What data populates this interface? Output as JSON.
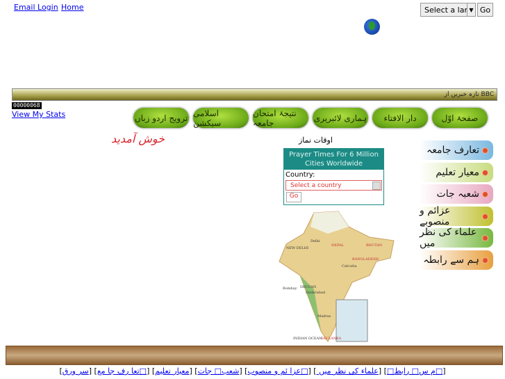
{
  "top": {
    "email_login": "Email Login",
    "home": "Home",
    "language_select": "Select a language",
    "go": "Go"
  },
  "news_ticker": "تازہ خبریں از BBC",
  "counter": "00000068",
  "view_stats": "View My Stats",
  "nav": [
    "صفحۂ اوّل",
    "دار الافتاء",
    "ہماری لائبریری",
    "نتیجۂ امتحان جامعہ",
    "اسلامی سیکشن",
    "ترویج اردو زباں"
  ],
  "welcome": "خوش آمدید",
  "prayer": {
    "title": "اوقات نماز",
    "header": "Prayer Times For 6 Million Cities Worldwide",
    "country_label": "Country:",
    "country_select": "Select a country",
    "go": "Go"
  },
  "map_labels": [
    "NEW DELHI",
    "Delhi",
    "NEPAL",
    "BHUTAN",
    "BANGLADESH",
    "Calcutta",
    "Bombay",
    "DECCAN",
    "Hyderabad",
    "Madras",
    "SRI LANKA",
    "INDIAN OCEAN"
  ],
  "side_menu": [
    {
      "label": "تعارف جامعہ",
      "color": "#7ab8e0"
    },
    {
      "label": "معیار تعلیم",
      "color": "#c8dc80"
    },
    {
      "label": "شعبہ جات",
      "color": "#e8a8c0"
    },
    {
      "label": "عزائم و منصوبے",
      "color": "#c0c030"
    },
    {
      "label": "علماء کی نظر میں",
      "color": "#78b840"
    },
    {
      "label": "ہم سے رابطہ",
      "color": "#e8a040"
    }
  ],
  "footer_links": [
    "سر ورق",
    "تعا رف جا مع□",
    "معیار تعلیم",
    "شعب□ جات",
    "عزا ئم و منصوب□",
    " علماء کی نظر میں",
    "□م س□ رابط□"
  ]
}
